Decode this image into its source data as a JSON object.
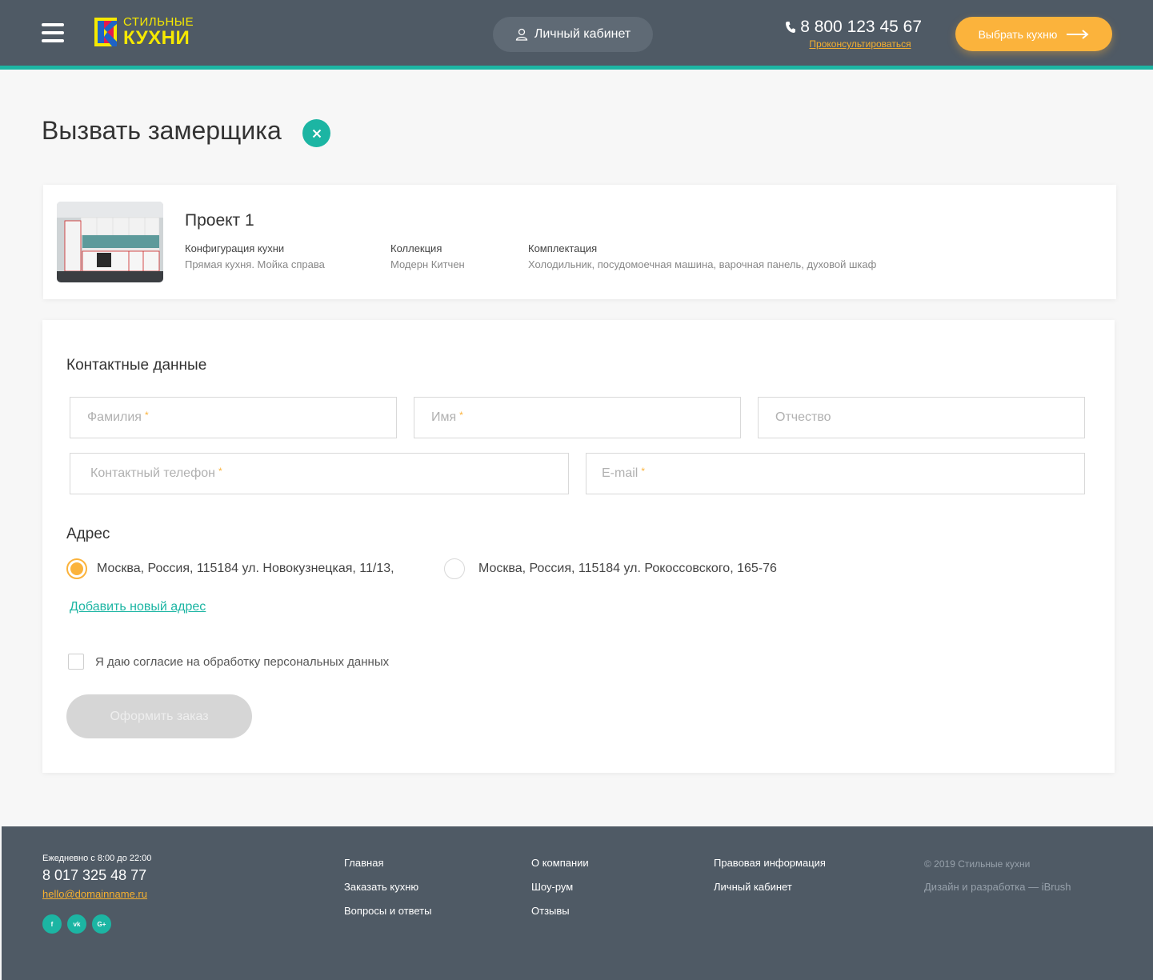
{
  "header": {
    "logo_line1": "СТИЛЬНЫЕ",
    "logo_line2": "КУХНИ",
    "cabinet_label": "Личный кабинет",
    "phone": "8 800 123 45 67",
    "consult_link": "Проконсультироваться",
    "choose_button": "Выбрать кухню",
    "colors": {
      "header_bg": "#4f5a65",
      "accent_teal": "#1cb5a3",
      "accent_orange": "#fbb33c",
      "logo_yellow": "#f6e900"
    }
  },
  "page": {
    "title": "Вызвать замерщика"
  },
  "project": {
    "name": "Проект 1",
    "specs": [
      {
        "label": "Конфигурация кухни",
        "value": "Прямая кухня. Мойка справа"
      },
      {
        "label": "Коллекция",
        "value": "Модерн Китчен"
      },
      {
        "label": "Комплектация",
        "value": "Холодильник, посудомоечная машина, варочная панель, духовой шкаф"
      }
    ]
  },
  "contact": {
    "title": "Контактные данные",
    "fields": [
      {
        "placeholder": "Фамилия",
        "required": true,
        "value": ""
      },
      {
        "placeholder": "Имя",
        "required": true,
        "value": ""
      },
      {
        "placeholder": "Отчество",
        "required": false,
        "value": ""
      },
      {
        "placeholder": "Контактный телефон",
        "required": true,
        "value": ""
      },
      {
        "placeholder": "E-mail",
        "required": true,
        "value": ""
      }
    ],
    "required_mark": "*"
  },
  "address": {
    "title": "Адрес",
    "options": [
      {
        "label": "Москва, Россия, 115184 ул. Новокузнецкая, 11/13,",
        "checked": true
      },
      {
        "label": "Москва, Россия, 115184 ул. Рокоссовского, 165-76",
        "checked": false
      }
    ],
    "add_link": "Добавить новый адрес"
  },
  "consent": {
    "label": "Я даю согласие на обработку персональных данных",
    "checked": false
  },
  "submit": {
    "label": "Оформить заказ",
    "disabled": true
  },
  "footer": {
    "hours": "Ежедневно с 8:00 до 22:00",
    "phone": "8 017 325 48 77",
    "email": "hello@domainname.ru",
    "socials": [
      "f",
      "vk",
      "G+"
    ],
    "links_col1": [
      "Главная",
      "Заказать кухню",
      "Вопросы и ответы"
    ],
    "links_col2": [
      "О компании",
      "Шоу-рум",
      "Отзывы"
    ],
    "links_col3": [
      "Правовая информация",
      "Личный кабинет"
    ],
    "copyright": "© 2019 Стильные кухни",
    "dev": "Дизайн и разработка — iBrush"
  }
}
